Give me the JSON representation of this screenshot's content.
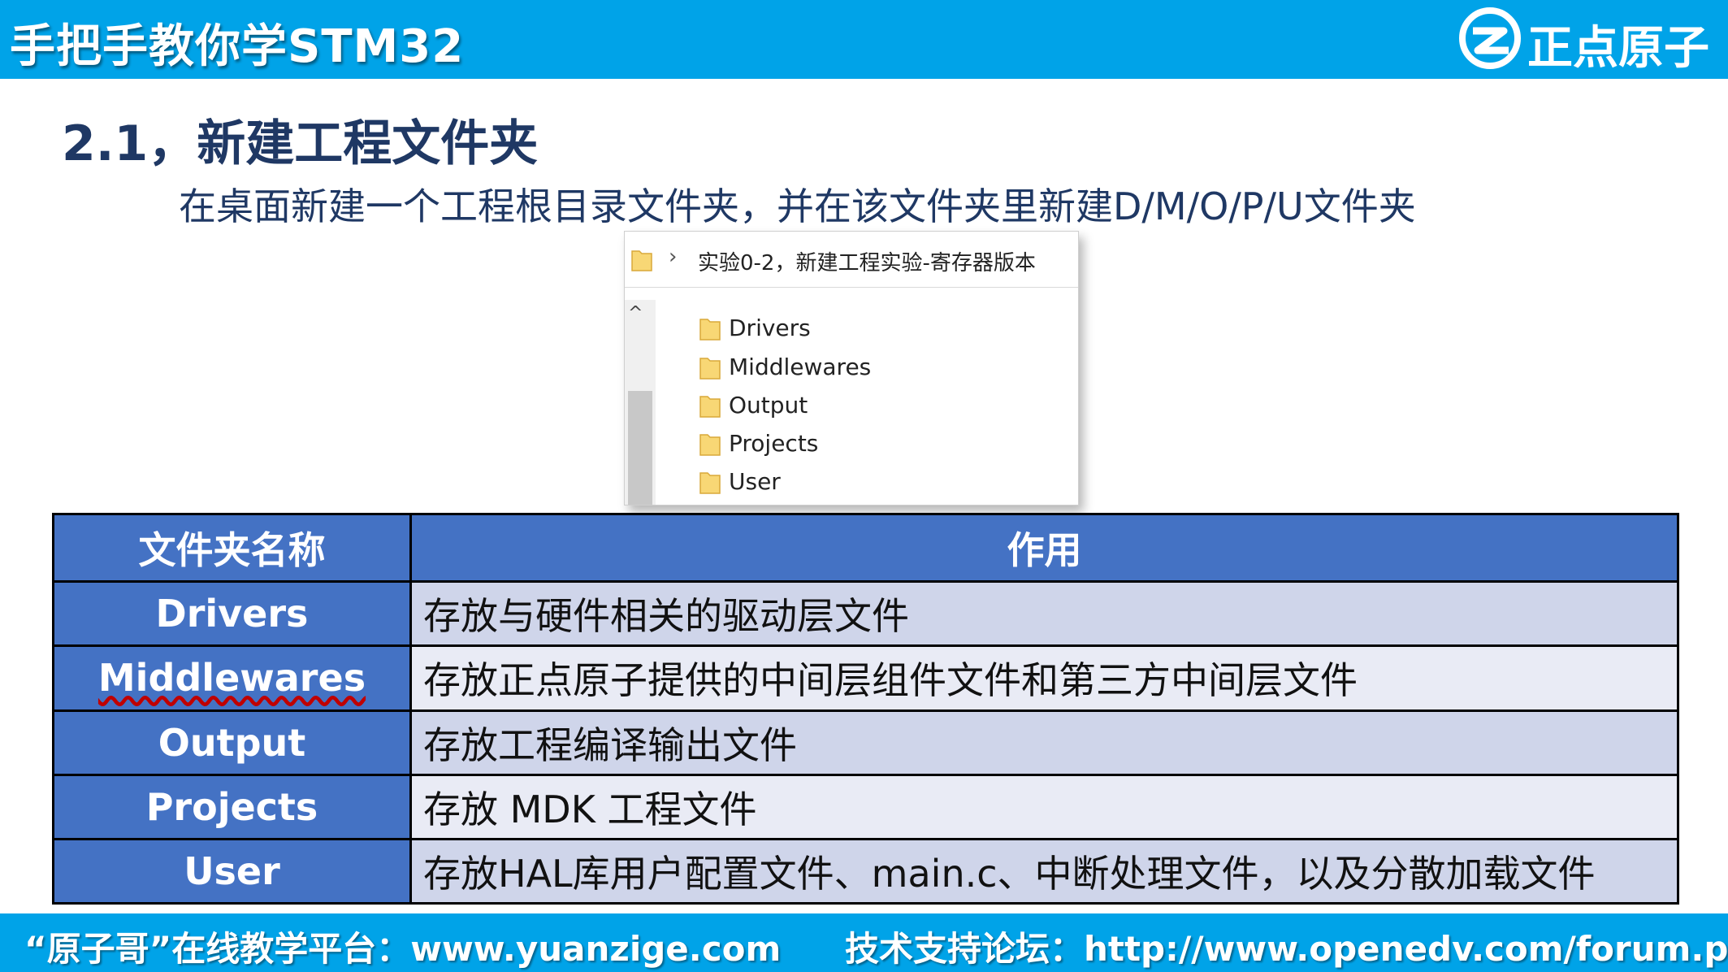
{
  "header": {
    "title": "手把手教你学STM32",
    "logo_icon": "zdyz-logo-icon",
    "logo_text": "正点原子"
  },
  "section": {
    "title": "2.1，新建工程文件夹",
    "subtitle": "在桌面新建一个工程根目录文件夹，并在该文件夹里新建D/M/O/P/U文件夹"
  },
  "explorer": {
    "path_chevron": "›",
    "path": "实验0-2，新建工程实验-寄存器版本",
    "scroll_up": "^",
    "folders": [
      "Drivers",
      "Middlewares",
      "Output",
      "Projects",
      "User"
    ],
    "folder_color": "#f8d775"
  },
  "table": {
    "headers": [
      "文件夹名称",
      "作用"
    ],
    "rows": [
      {
        "name": "Drivers",
        "desc": "存放与硬件相关的驱动层文件"
      },
      {
        "name": "Middlewares",
        "desc": "存放正点原子提供的中间层组件文件和第三方中间层文件"
      },
      {
        "name": "Output",
        "desc": "存放工程编译输出文件"
      },
      {
        "name": "Projects",
        "desc": "存放 MDK 工程文件"
      },
      {
        "name": "User",
        "desc": "存放HAL库用户配置文件、main.c、中断处理文件，以及分散加载文件"
      }
    ],
    "header_color": "#4472c4"
  },
  "footer": {
    "left": "“原子哥”在线教学平台：www.yuanzige.com",
    "right": "技术支持论坛：http://www.openedv.com/forum.php"
  },
  "colors": {
    "brand": "#00a3e8",
    "title_text": "#1f3864"
  }
}
